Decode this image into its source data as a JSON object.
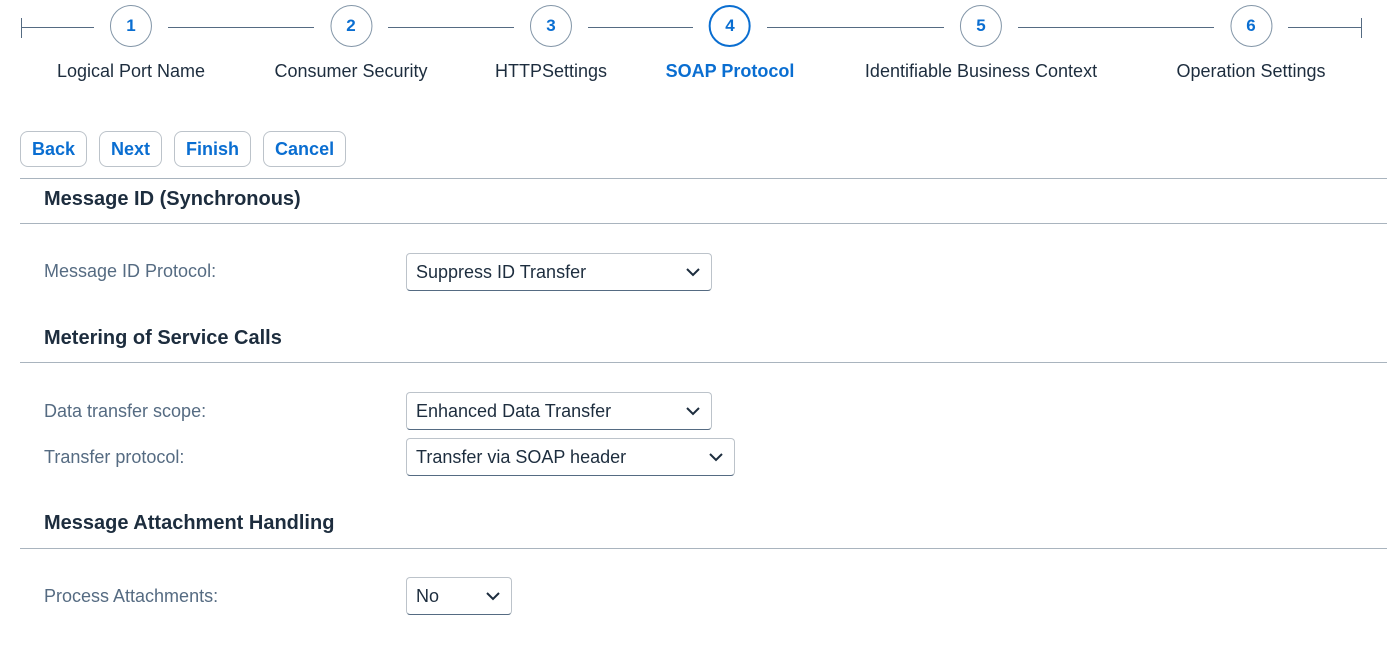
{
  "wizard": {
    "steps": [
      {
        "number": "1",
        "label": "Logical Port Name"
      },
      {
        "number": "2",
        "label": "Consumer Security"
      },
      {
        "number": "3",
        "label": "HTTPSettings"
      },
      {
        "number": "4",
        "label": "SOAP Protocol"
      },
      {
        "number": "5",
        "label": "Identifiable Business Context"
      },
      {
        "number": "6",
        "label": "Operation Settings"
      }
    ],
    "active_step": "4"
  },
  "toolbar": {
    "back_label": "Back",
    "next_label": "Next",
    "finish_label": "Finish",
    "cancel_label": "Cancel"
  },
  "sections": {
    "message_id": {
      "title": "Message ID (Synchronous)",
      "protocol_label": "Message ID Protocol:",
      "protocol_value": "Suppress ID Transfer"
    },
    "metering": {
      "title": "Metering of Service Calls",
      "scope_label": "Data transfer scope:",
      "scope_value": "Enhanced Data Transfer",
      "protocol_label": "Transfer protocol:",
      "protocol_value": "Transfer via SOAP header"
    },
    "attachments": {
      "title": "Message Attachment Handling",
      "process_label": "Process Attachments:",
      "process_value": "No"
    }
  },
  "colors": {
    "accent": "#0a6ed1",
    "text": "#1d2d3e",
    "label": "#556b82"
  }
}
